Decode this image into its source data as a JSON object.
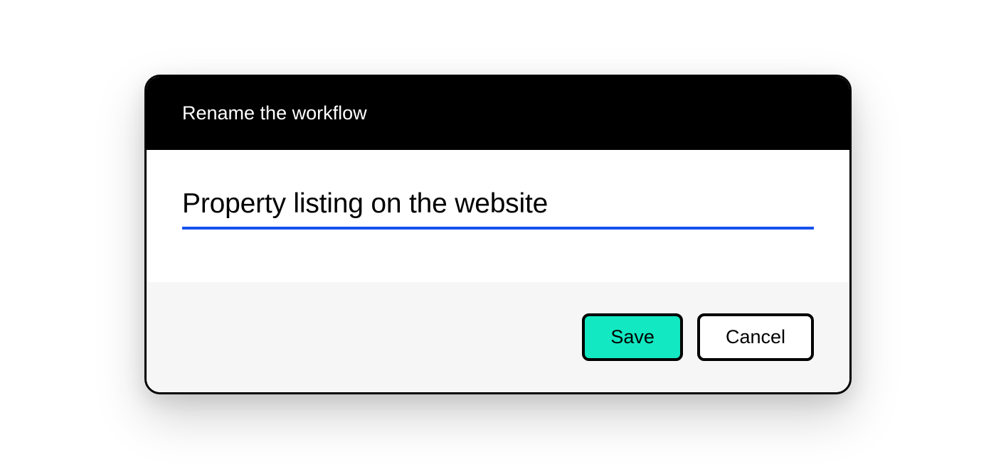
{
  "dialog": {
    "title": "Rename the workflow",
    "input_value": "Property listing on the website",
    "buttons": {
      "save_label": "Save",
      "cancel_label": "Cancel"
    }
  },
  "colors": {
    "accent": "#12e8c2",
    "underline": "#1651ef",
    "header_bg": "#000000",
    "footer_bg": "#f6f6f6"
  }
}
